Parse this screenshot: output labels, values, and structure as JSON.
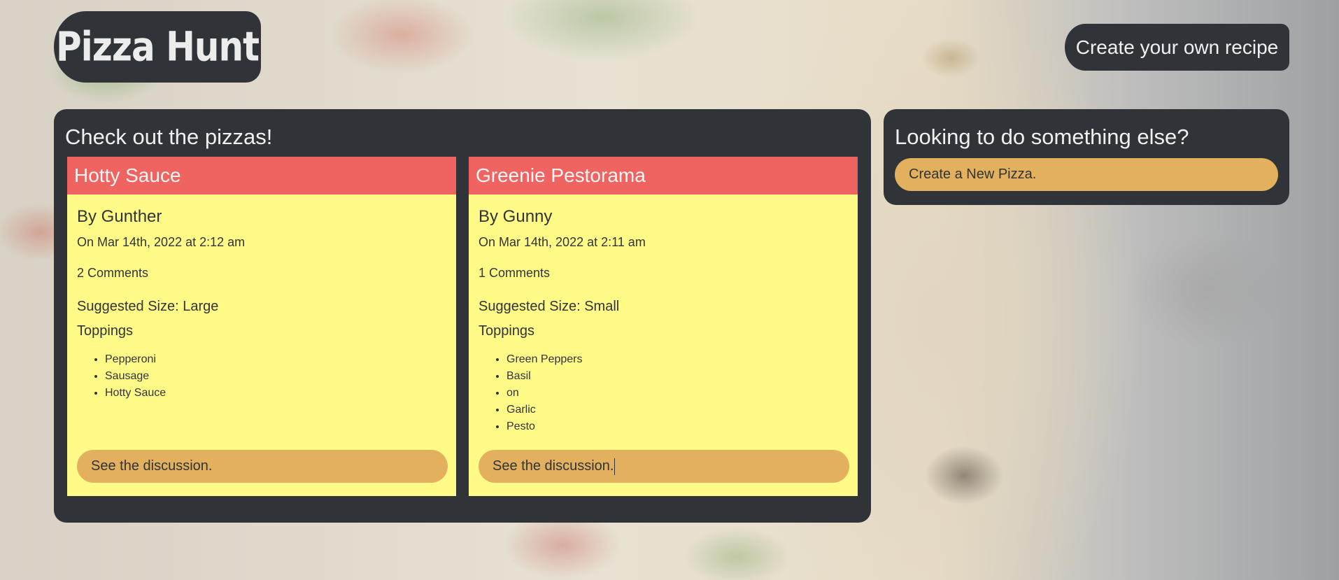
{
  "header": {
    "logo_text": "Pizza Hunt",
    "create_recipe_label": "Create your own recipe"
  },
  "main": {
    "title": "Check out the pizzas!",
    "cards": [
      {
        "name": "Hotty Sauce",
        "author": "By Gunther",
        "date": "On Mar 14th, 2022 at 2:12 am",
        "comments": "2 Comments",
        "size": "Suggested Size: Large",
        "toppings_label": "Toppings",
        "toppings": [
          "Pepperoni",
          "Sausage",
          "Hotty Sauce"
        ],
        "button_label": "See the discussion."
      },
      {
        "name": "Greenie Pestorama",
        "author": "By Gunny",
        "date": "On Mar 14th, 2022 at 2:11 am",
        "comments": "1 Comments",
        "size": "Suggested Size: Small",
        "toppings_label": "Toppings",
        "toppings": [
          "Green Peppers",
          "Basil",
          "on",
          "Garlic",
          "Pesto"
        ],
        "button_label": "See the discussion."
      }
    ]
  },
  "sidebar": {
    "title": "Looking to do something else?",
    "new_pizza_label": "Create a New Pizza."
  },
  "colors": {
    "panel": "#303438",
    "card_header": "#ef6461",
    "card_body": "#fffb86",
    "button": "#e3b05d"
  }
}
